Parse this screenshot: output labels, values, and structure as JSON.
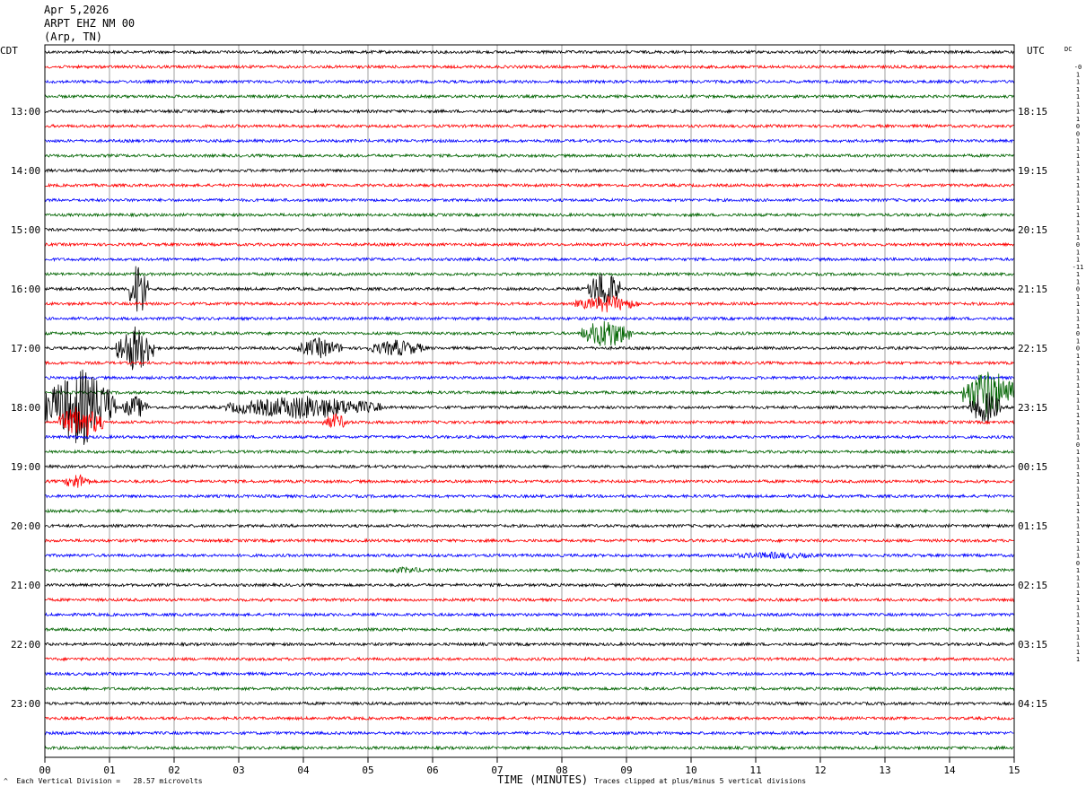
{
  "header": {
    "date": "Apr 5,2026",
    "station": "ARPT EHZ NM 00",
    "location": "(Arp, TN)"
  },
  "left_timezone": "CDT",
  "right_timezone": "UTC",
  "dc_header": "DC",
  "footer": {
    "scale_note": "Each Vertical Division =   28.57 microvolts",
    "clip_note": "Traces clipped at plus/minus 5 vertical divisions",
    "mark": "^"
  },
  "chart_data": {
    "type": "line",
    "title": "",
    "xlabel": "TIME (MINUTES)",
    "ylabel": "",
    "xlim": [
      0,
      15
    ],
    "x_ticks": [
      "00",
      "01",
      "02",
      "03",
      "04",
      "05",
      "06",
      "07",
      "08",
      "09",
      "10",
      "11",
      "12",
      "13",
      "14",
      "15"
    ],
    "grid": true,
    "trace_colors": [
      "#000000",
      "#ff0000",
      "#0000ff",
      "#006400"
    ],
    "trace_count": 48,
    "traces_per_hour": 4,
    "left_hour_labels": [
      "13:00",
      "14:00",
      "15:00",
      "16:00",
      "17:00",
      "18:00",
      "19:00",
      "20:00",
      "21:00",
      "22:00",
      "23:00"
    ],
    "left_label_first_trace": 4,
    "right_hour_labels": [
      "18:15",
      "19:15",
      "20:15",
      "21:15",
      "22:15",
      "23:15",
      "00:15",
      "01:15",
      "02:15",
      "03:15",
      "04:15"
    ],
    "dc_offsets": [
      "-0",
      "1",
      "1",
      "1",
      "1",
      "1",
      "1",
      "1",
      "0",
      "0",
      "1",
      "1",
      "1",
      "1",
      "1",
      "1",
      "1",
      "1",
      "1",
      "1",
      "1",
      "1",
      "1",
      "1",
      "0",
      "1",
      "1",
      "-11",
      "1",
      "1",
      "0",
      "1",
      "1",
      "1",
      "1",
      "1",
      "0",
      "1",
      "0",
      "1",
      "1",
      "1",
      "1",
      "1",
      "1",
      "1",
      "1",
      "1",
      "1",
      "1",
      "1",
      "0",
      "1",
      "1",
      "1",
      "1",
      "1",
      "1",
      "1",
      "1",
      "1",
      "1",
      "1",
      "1",
      "1",
      "1",
      "1",
      "0",
      "1",
      "1",
      "1",
      "1",
      "1",
      "1",
      "1",
      "1",
      "1",
      "1",
      "1",
      "1",
      "1"
    ],
    "events": [
      {
        "trace": 16,
        "start_min": 1.3,
        "end_min": 1.6,
        "amplitude": 35
      },
      {
        "trace": 16,
        "start_min": 8.4,
        "end_min": 8.9,
        "amplitude": 25
      },
      {
        "trace": 17,
        "start_min": 8.2,
        "end_min": 9.2,
        "amplitude": 10
      },
      {
        "trace": 19,
        "start_min": 8.3,
        "end_min": 9.1,
        "amplitude": 18
      },
      {
        "trace": 20,
        "start_min": 1.1,
        "end_min": 1.7,
        "amplitude": 28
      },
      {
        "trace": 20,
        "start_min": 3.9,
        "end_min": 4.6,
        "amplitude": 12
      },
      {
        "trace": 20,
        "start_min": 5.0,
        "end_min": 5.9,
        "amplitude": 10
      },
      {
        "trace": 23,
        "start_min": 14.2,
        "end_min": 15.0,
        "amplitude": 30
      },
      {
        "trace": 24,
        "start_min": 0.0,
        "end_min": 1.1,
        "amplitude": 45
      },
      {
        "trace": 24,
        "start_min": 1.2,
        "end_min": 1.6,
        "amplitude": 14
      },
      {
        "trace": 24,
        "start_min": 2.8,
        "end_min": 5.2,
        "amplitude": 14
      },
      {
        "trace": 24,
        "start_min": 14.3,
        "end_min": 14.8,
        "amplitude": 20
      },
      {
        "trace": 25,
        "start_min": 0.2,
        "end_min": 0.9,
        "amplitude": 20
      },
      {
        "trace": 25,
        "start_min": 4.3,
        "end_min": 4.7,
        "amplitude": 10
      },
      {
        "trace": 29,
        "start_min": 0.3,
        "end_min": 0.7,
        "amplitude": 10
      },
      {
        "trace": 34,
        "start_min": 10.3,
        "end_min": 12.2,
        "amplitude": 4
      },
      {
        "trace": 35,
        "start_min": 5.2,
        "end_min": 6.0,
        "amplitude": 4
      }
    ]
  }
}
